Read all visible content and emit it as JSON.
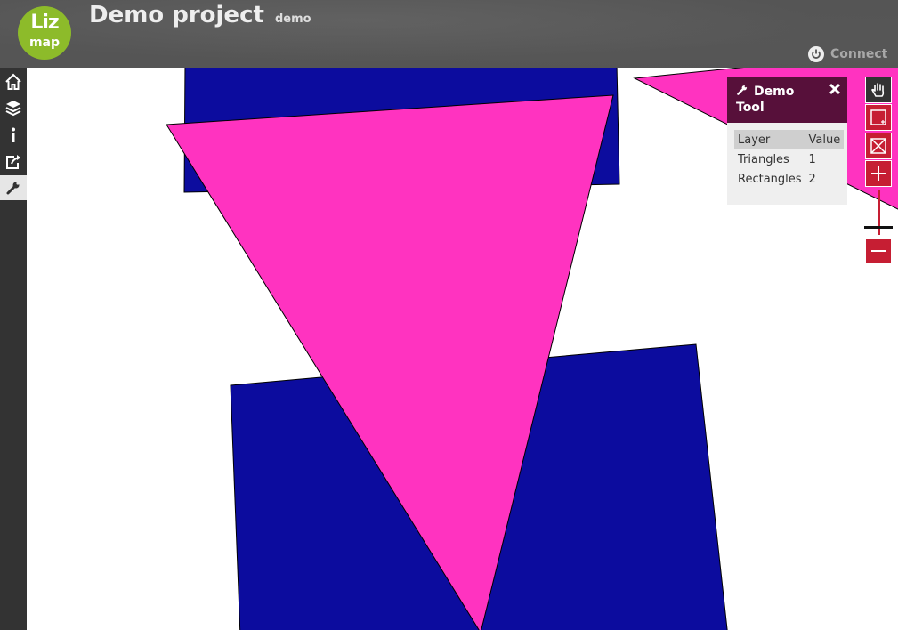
{
  "header": {
    "logo_line1": "Liz",
    "logo_line2": "map",
    "title": "Demo project",
    "subtitle": "demo",
    "connect_label": "Connect"
  },
  "sidebar": {
    "items": [
      {
        "icon": "home-icon",
        "active": false
      },
      {
        "icon": "layers-icon",
        "active": false
      },
      {
        "icon": "info-icon",
        "active": false
      },
      {
        "icon": "share-icon",
        "active": false
      },
      {
        "icon": "wrench-icon",
        "active": true
      }
    ]
  },
  "dock": {
    "title": "Demo Tool",
    "columns": [
      "Layer",
      "Value"
    ],
    "rows": [
      {
        "layer": "Triangles",
        "value": "1"
      },
      {
        "layer": "Rectangles",
        "value": "2"
      }
    ]
  },
  "map_tools": [
    "pan-icon",
    "zoom-box-icon",
    "zoom-extent-icon",
    "zoom-in-icon",
    "zoom-out-icon"
  ],
  "colors": {
    "rectangle_fill": "#0c0c9e",
    "triangle_fill": "#ff33c0",
    "accent": "#c61e33",
    "dock_header": "#57103a",
    "logo": "#8dbb2a"
  }
}
